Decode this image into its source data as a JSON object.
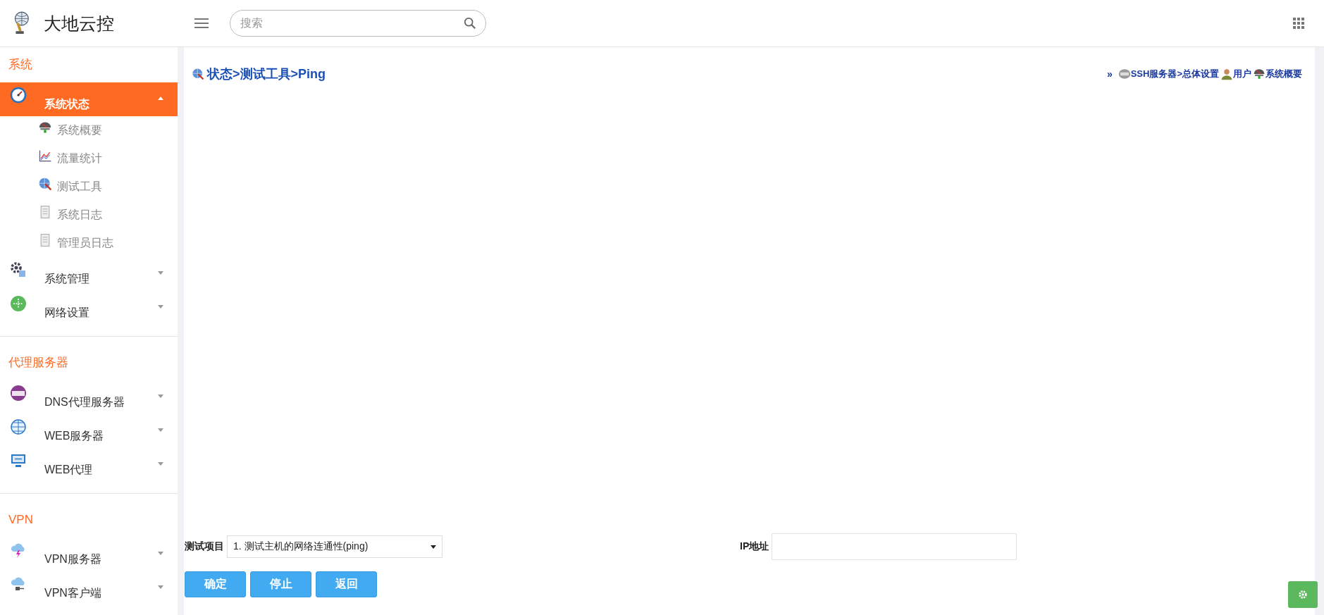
{
  "header": {
    "logo_text": "大地云控",
    "search": {
      "placeholder": "搜索"
    }
  },
  "sidebar": {
    "sections": [
      {
        "title": "系统",
        "items": [
          {
            "label": "系统状态",
            "kind": "gauge",
            "selected": true,
            "expanded": true,
            "children": [
              {
                "label": "系统概要",
                "kind": "monitor"
              },
              {
                "label": "流量统计",
                "kind": "chart"
              },
              {
                "label": "测试工具",
                "kind": "globe"
              },
              {
                "label": "系统日志",
                "kind": "doc"
              },
              {
                "label": "管理员日志",
                "kind": "doc"
              }
            ]
          },
          {
            "label": "系统管理",
            "kind": "gear",
            "selected": false,
            "expanded": false
          },
          {
            "label": "网络设置",
            "kind": "network",
            "selected": false,
            "expanded": false
          }
        ]
      },
      {
        "title": "代理服务器",
        "items": [
          {
            "label": "DNS代理服务器",
            "kind": "dns",
            "selected": false,
            "expanded": false
          },
          {
            "label": "WEB服务器",
            "kind": "www",
            "selected": false,
            "expanded": false
          },
          {
            "label": "WEB代理",
            "kind": "screen",
            "selected": false,
            "expanded": false
          }
        ]
      },
      {
        "title": "VPN",
        "items": [
          {
            "label": "VPN服务器",
            "kind": "cloud-bolt",
            "selected": false,
            "expanded": false
          },
          {
            "label": "VPN客户端",
            "kind": "cloud-plug",
            "selected": false,
            "expanded": false
          }
        ]
      }
    ]
  },
  "breadcrumb": {
    "kind": "globe",
    "text": "状态>测试工具>Ping"
  },
  "quick_links": {
    "prefix": "»",
    "items": [
      {
        "label": "SSH服务器>总体设置",
        "kind": "ssh"
      },
      {
        "label": "用户",
        "kind": "user"
      },
      {
        "label": "系统概要",
        "kind": "monitor"
      }
    ]
  },
  "form": {
    "test_item": {
      "label": "测试项目",
      "value": "1. 测试主机的网络连通性(ping)"
    },
    "ip": {
      "label": "IP地址"
    }
  },
  "buttons": [
    "确定",
    "停止",
    "返回"
  ]
}
